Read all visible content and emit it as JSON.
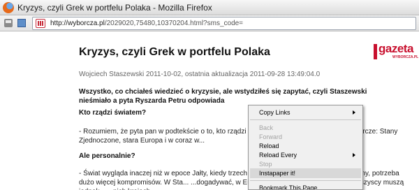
{
  "window": {
    "title": "Kryzys, czyli Grek w portfelu Polaka - Mozilla Firefox"
  },
  "toolbar": {
    "url_host": "http://wyborcza.pl",
    "url_path": "/2029020,75480,10370204.html?sms_code="
  },
  "article": {
    "title": "Kryzys, czyli Grek w portfelu Polaka",
    "logo_text": "gazeta",
    "logo_subtext": "WYBORCZA.PL",
    "byline": "Wojciech Staszewski 2011-10-02, ostatnia aktualizacja 2011-09-28 13:49:04.0",
    "lead": "Wszystko, co chciałeś wiedzieć o kryzysie, ale wstydziłeś się zapytać, czyli Staszewski nieśmiało a pyta Ryszarda Petru odpowiada",
    "q1": "Kto rządzi światem?",
    "p1": "- Rozumiem, że pyta pan w podtekście o to, kto rządzi rynka... ...największe potęgi gospodarcze: Stany Zjednoczone, stara Europa i w coraz w...",
    "q2": "Ale personalnie?",
    "p2": "- Świat wygląda inaczej niż w epoce Jałty, kiedy trzech panó... ...dużo bardziej demokratyczny, potrzeba dużo więcej kompromisów. W Sta... ...dogadywać, w Europie mamy kilkoro przywódców. Wszyscy muszą jednak... ...nich krajach"
  },
  "context_menu": {
    "items": [
      {
        "label": "Copy Links",
        "enabled": true,
        "submenu": true,
        "hover": false
      },
      {
        "separator": true
      },
      {
        "label": "Back",
        "enabled": false
      },
      {
        "label": "Forward",
        "enabled": false
      },
      {
        "label": "Reload",
        "enabled": true
      },
      {
        "label": "Reload Every",
        "enabled": true,
        "submenu": true
      },
      {
        "label": "Stop",
        "enabled": false
      },
      {
        "label": "Instapaper it!",
        "enabled": true,
        "hover": true
      },
      {
        "separator": true
      },
      {
        "label": "Bookmark This Page",
        "enabled": true
      }
    ]
  },
  "colors": {
    "brand": "#c8102e",
    "menu_bg": "#f0f0f0",
    "menu_hover": "#d8d8d8"
  }
}
